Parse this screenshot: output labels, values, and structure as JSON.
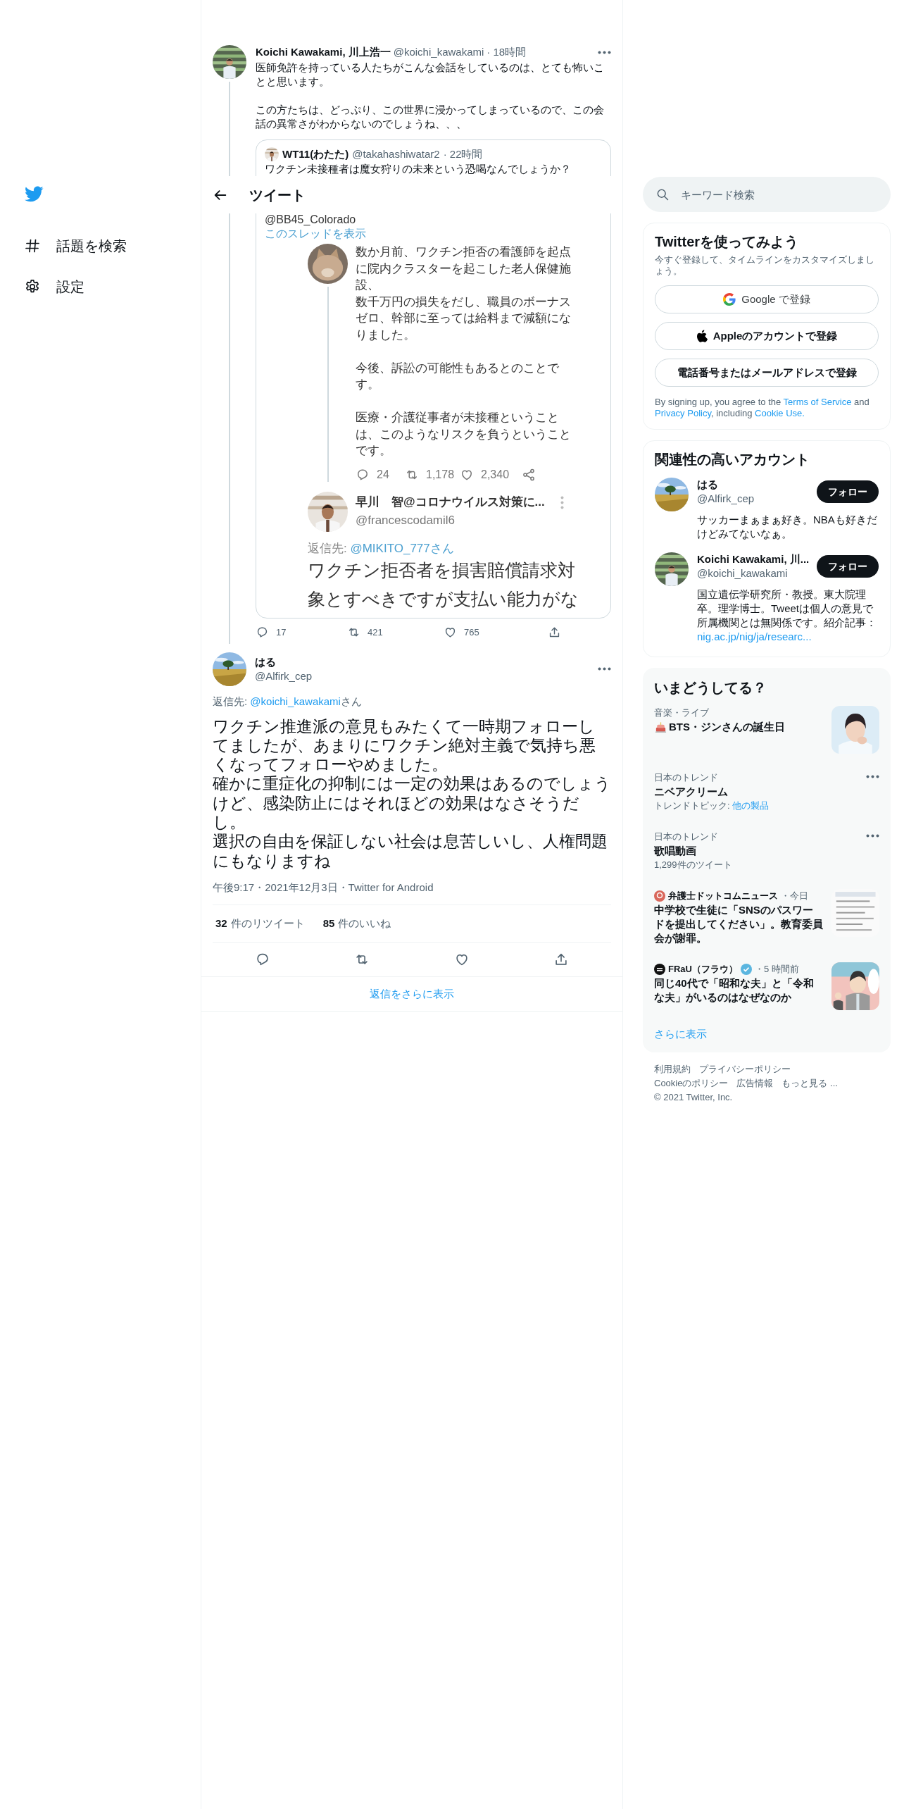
{
  "nav": {
    "items": [
      {
        "label": "話題を検索"
      },
      {
        "label": "設定"
      }
    ]
  },
  "header": {
    "title": "ツイート"
  },
  "parent_tweet": {
    "author": "Koichi Kawakami, 川上浩一",
    "handle": "@koichi_kawakami",
    "time": "· 18時間",
    "paragraphs": [
      "医師免許を持っている人たちがこんな会話をしているのは、とても怖いことと思います。",
      "この方たちは、どっぷり、この世界に浸かってしまっているので、この会話の異常さがわからないのでしょうね、、、"
    ],
    "quote": {
      "author": "WT11(わたた)",
      "handle": "@takahashiwatar2",
      "time": "· 22時間",
      "text": "ワクチン未接種者は魔女狩りの未来という恐喝なんでしょうか？",
      "screenshot": {
        "handle": "@BB45_Colorado",
        "thread_link": "このスレッドを表示",
        "post": {
          "paragraphs": [
            [
              "数か月前、ワクチン拒否の看護師を起点に院内クラスターを起こした老人保健施設、",
              "数千万円の損失をだし、職員のボーナスゼロ、幹部に至っては給料まで減額になりました。"
            ],
            [
              "今後、訴訟の可能性もあるとのことです。"
            ],
            [
              "医療・介護従事者が未接種ということは、このようなリスクを負うということです。"
            ]
          ],
          "replies": "24",
          "retweets": "1,178",
          "likes": "2,340"
        },
        "reply": {
          "author": "早川　智@コロナウイルス対策に...",
          "handle": "@francescodamil6",
          "reply_label": "返信先: ",
          "reply_to": "@MIKITO_777さん",
          "text": "ワクチン拒否者を損害賠償請求対象とすべきですが支払い能力がな"
        }
      }
    },
    "replies": "17",
    "retweets": "421",
    "likes": "765"
  },
  "focus_tweet": {
    "author": "はる",
    "handle": "@Alfirk_cep",
    "reply_label": "返信先: ",
    "reply_to": "@koichi_kawakami",
    "reply_suffix": "さん",
    "lines": [
      "ワクチン推進派の意見もみたくて一時期フォローしてましたが、あまりにワクチン絶対主義で気持ち悪くなってフォローやめました。",
      "確かに重症化の抑制には一定の効果はあるのでしょうけど、感染防止にはそれほどの効果はなさそうだし。",
      "選択の自由を保証しない社会は息苦しいし、人権問題にもなりますね"
    ],
    "meta": "午後9:17・2021年12月3日・Twitter for Android",
    "counts": [
      {
        "count": "32",
        "text": "件のリツイート"
      },
      {
        "count": "85",
        "text": "件のいいね"
      }
    ]
  },
  "more_replies": "返信をさらに表示",
  "search": {
    "placeholder": "キーワード検索"
  },
  "signup": {
    "title": "Twitterを使ってみよう",
    "subtitle": "今すぐ登録して、タイムラインをカスタマイズしましょう。",
    "buttons": [
      {
        "kind": "google",
        "label": "Google で登録"
      },
      {
        "kind": "apple",
        "label": "Appleのアカウントで登録"
      },
      {
        "kind": "plain",
        "label": "電話番号またはメールアドレスで登録"
      }
    ],
    "legal": [
      {
        "text": "By signing up, you agree to the ",
        "link": false
      },
      {
        "text": "Terms of Service",
        "link": true
      },
      {
        "text": " and ",
        "link": false
      },
      {
        "text": "Privacy Policy",
        "link": true
      },
      {
        "text": ", including ",
        "link": false
      },
      {
        "text": "Cookie Use.",
        "link": true
      }
    ]
  },
  "who_to_follow": {
    "title": "関連性の高いアカウント",
    "accounts": [
      {
        "name": "はる",
        "handle": "@Alfirk_cep",
        "bio": "サッカーまぁまぁ好き。NBAも好きだけどみてないなぁ。",
        "button": "フォロー"
      },
      {
        "name": "Koichi Kawakami, 川...",
        "handle": "@koichi_kawakami",
        "bio": "国立遺伝学研究所・教授。東大院理卒。理学博士。Tweetは個人の意見で所属機関とは無関係です。紹介記事：",
        "bio_link": "nig.ac.jp/nig/ja/researc...",
        "button": "フォロー"
      }
    ]
  },
  "trends": {
    "title": "いまどうしてる？",
    "items": [
      {
        "kind": "event",
        "category": "音楽・ライブ",
        "title": "BTS・ジンさんの誕生日"
      },
      {
        "kind": "trend",
        "category": "日本のトレンド",
        "title": "ニベアクリーム",
        "sub_label": "トレンドトピック: ",
        "sub_link": "他の製品"
      },
      {
        "kind": "trend",
        "category": "日本のトレンド",
        "title": "歌唱動画",
        "sub_label": "1,299件のツイート"
      },
      {
        "kind": "news",
        "source": "弁護士ドットコムニュース",
        "verified": false,
        "time": "・今日",
        "title": "中学校で生徒に「SNSのパスワードを提出してください」。教育委員会が謝罪。"
      },
      {
        "kind": "news",
        "source": "FRaU（フラウ）",
        "verified": true,
        "time": "・5 時間前",
        "title": "同じ40代で「昭和な夫」と「令和な夫」がいるのはなぜなのか"
      }
    ],
    "more": "さらに表示"
  },
  "footer": {
    "links": [
      "利用規約",
      "プライバシーポリシー",
      "Cookieのポリシー",
      "広告情報",
      "もっと見る ..."
    ],
    "copyright": "© 2021 Twitter, Inc."
  }
}
